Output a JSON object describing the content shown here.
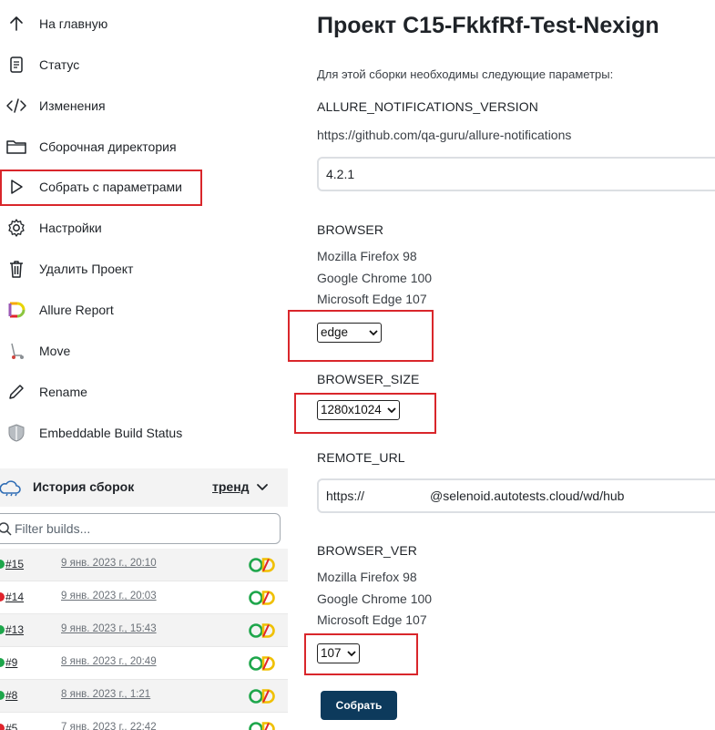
{
  "sidebar": {
    "items": [
      {
        "label": "На главную",
        "icon": "arrow-up-icon"
      },
      {
        "label": "Статус",
        "icon": "document-icon"
      },
      {
        "label": "Изменения",
        "icon": "code-icon"
      },
      {
        "label": "Сборочная директория",
        "icon": "folder-icon"
      },
      {
        "label": "Собрать с параметрами",
        "icon": "play-icon"
      },
      {
        "label": "Настройки",
        "icon": "gear-icon"
      },
      {
        "label": "Удалить Проект",
        "icon": "trash-icon"
      },
      {
        "label": "Allure Report",
        "icon": "allure-icon"
      },
      {
        "label": "Move",
        "icon": "scooter-icon"
      },
      {
        "label": "Rename",
        "icon": "pencil-icon"
      },
      {
        "label": "Embeddable Build Status",
        "icon": "shield-icon"
      }
    ],
    "history": {
      "title": "История сборок",
      "trend": "тренд",
      "filter_placeholder": "Filter builds...",
      "builds": [
        {
          "num": "#15",
          "date": "9 янв. 2023 г., 20:10",
          "status_color": "#1ea64b"
        },
        {
          "num": "#14",
          "date": "9 янв. 2023 г., 20:03",
          "status_color": "#e0242c"
        },
        {
          "num": "#13",
          "date": "9 янв. 2023 г., 15:43",
          "status_color": "#1ea64b"
        },
        {
          "num": "#9",
          "date": "8 янв. 2023 г., 20:49",
          "status_color": "#1ea64b"
        },
        {
          "num": "#8",
          "date": "8 янв. 2023 г., 1:21",
          "status_color": "#1ea64b"
        },
        {
          "num": "#5",
          "date": "7 янв. 2023 г., 22:42",
          "status_color": "#e0242c"
        }
      ]
    }
  },
  "main": {
    "title": "Проект C15-FkkfRf-Test-Nexign",
    "intro": "Для этой сборки необходимы следующие параметры:",
    "params": {
      "allure": {
        "name": "ALLURE_NOTIFICATIONS_VERSION",
        "description": "https://github.com/qa-guru/allure-notifications",
        "value": "4.2.1"
      },
      "browser": {
        "name": "BROWSER",
        "lines": [
          "Mozilla Firefox 98",
          "Google Chrome 100",
          "Microsoft Edge 107"
        ],
        "selected": "edge"
      },
      "browser_size": {
        "name": "BROWSER_SIZE",
        "selected": "1280x1024"
      },
      "remote_url": {
        "name": "REMOTE_URL",
        "value_start": "https://",
        "value_end": "@selenoid.autotests.cloud/wd/hub"
      },
      "browser_ver": {
        "name": "BROWSER_VER",
        "lines": [
          "Mozilla Firefox 98",
          "Google Chrome 100",
          "Microsoft Edge 107"
        ],
        "selected": "107"
      }
    },
    "submit_label": "Собрать"
  },
  "colors": {
    "highlight": "#d9262b",
    "button": "#0d3a5c",
    "success": "#1ea64b",
    "failure": "#e0242c"
  }
}
